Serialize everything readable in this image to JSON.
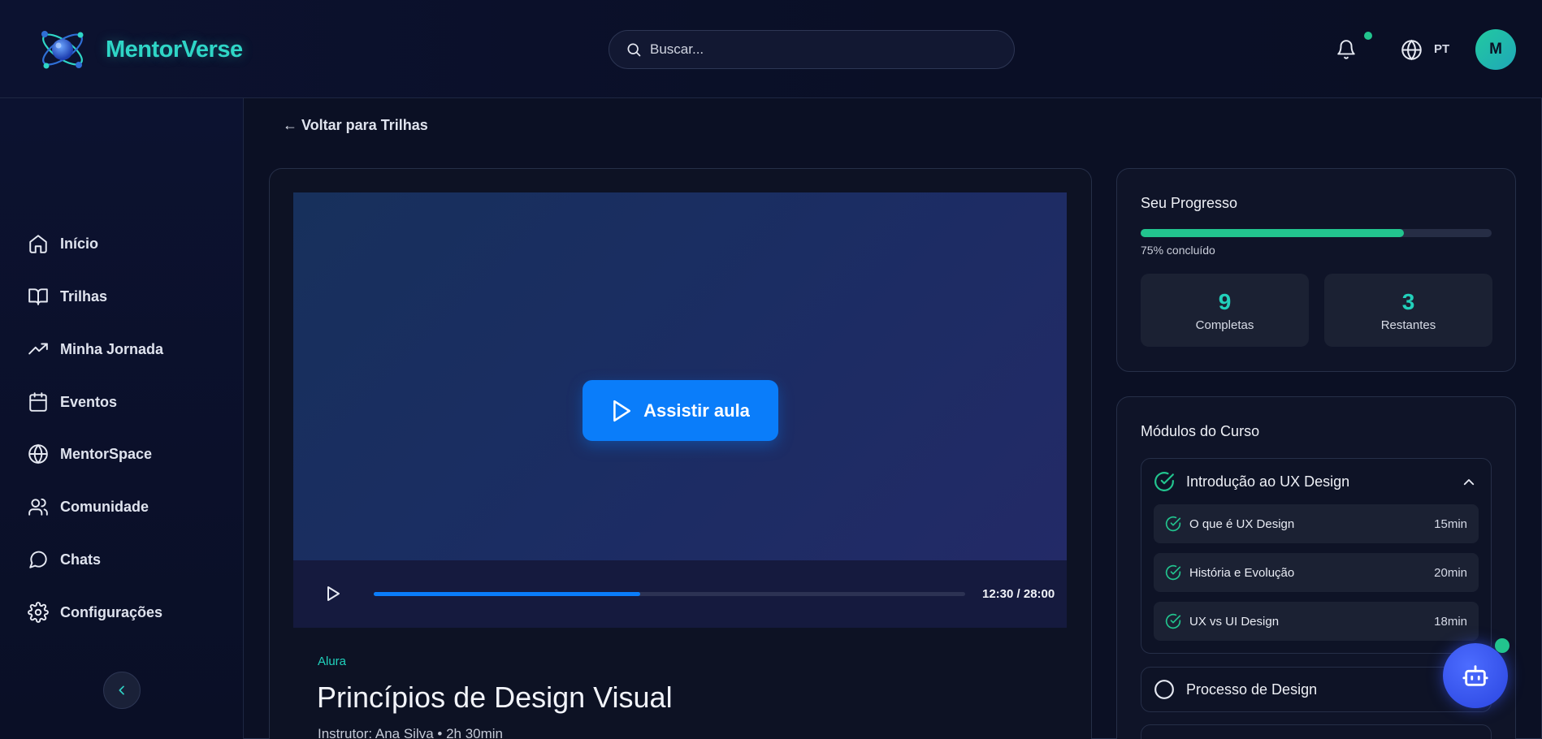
{
  "app": {
    "name": "MentorVerse",
    "logo_icon": "atom-logo"
  },
  "header": {
    "search_placeholder": "Buscar...",
    "language": "PT",
    "avatar_initial": "M",
    "notification_icon": "bell-icon",
    "language_icon": "globe-icon"
  },
  "sidebar": {
    "items": [
      {
        "label": "Início",
        "icon": "home-icon"
      },
      {
        "label": "Trilhas",
        "icon": "book-icon"
      },
      {
        "label": "Minha Jornada",
        "icon": "trending-up-icon"
      },
      {
        "label": "Eventos",
        "icon": "calendar-icon"
      },
      {
        "label": "MentorSpace",
        "icon": "globe-icon"
      },
      {
        "label": "Comunidade",
        "icon": "users-icon"
      },
      {
        "label": "Chats",
        "icon": "chat-icon"
      },
      {
        "label": "Configurações",
        "icon": "gear-icon"
      }
    ],
    "collapse_icon": "chevron-left-icon"
  },
  "main": {
    "back_link": "← Voltar para Trilhas",
    "watch_button": "Assistir aula",
    "player": {
      "time": "12:30 / 28:00",
      "progress": 0.45
    },
    "provider": "Alura",
    "title": "Princípios de Design Visual",
    "meta": "Instrutor: Ana Silva • 2h 30min"
  },
  "progress": {
    "title": "Seu Progresso",
    "percent": 0.75,
    "percent_label": "75% concluído",
    "completed_value": "9",
    "completed_label": "Completas",
    "remaining_value": "3",
    "remaining_label": "Restantes"
  },
  "modules": {
    "title": "Módulos do Curso",
    "items": [
      {
        "title": "Introdução ao UX Design",
        "completed": true,
        "expanded": true,
        "lessons": [
          {
            "title": "O que é UX Design",
            "duration": "15min"
          },
          {
            "title": "História e Evolução",
            "duration": "20min"
          },
          {
            "title": "UX vs UI Design",
            "duration": "18min"
          }
        ]
      },
      {
        "title": "Processo de Design",
        "completed": false,
        "expanded": false
      }
    ]
  },
  "colors": {
    "accent_teal": "#2fd6c7",
    "accent_green": "#22c48e",
    "accent_blue": "#0a7dfa",
    "background": "#0b1024"
  },
  "assistant": {
    "icon": "bot-icon"
  }
}
